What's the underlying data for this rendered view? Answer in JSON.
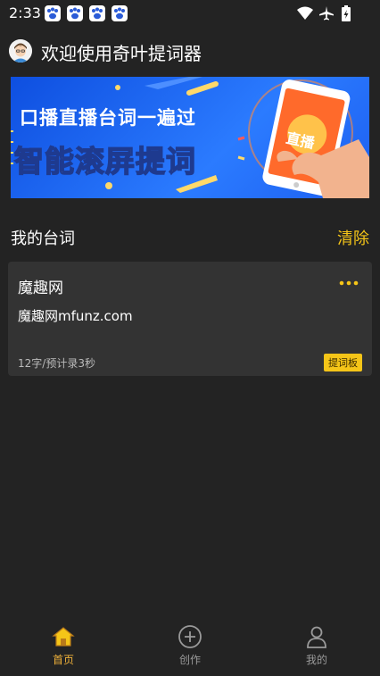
{
  "status_bar": {
    "time": "2:33",
    "notification_icons": [
      "baidu-paw-icon",
      "baidu-paw-icon",
      "baidu-paw-icon",
      "baidu-paw-icon"
    ],
    "system_icons": [
      "wifi-icon",
      "airplane-icon",
      "battery-charging-icon"
    ]
  },
  "header": {
    "title": "欢迎使用奇叶提词器",
    "avatar_icon": "avatar-icon"
  },
  "banner": {
    "line1": "口播直播台词一遍过",
    "line2": "智能滚屏提词",
    "phone_label": "直播"
  },
  "section": {
    "title": "我的台词",
    "clear_label": "清除"
  },
  "scripts": [
    {
      "title": "魔趣网",
      "content": "魔趣网mfunz.com",
      "meta": "12字/预计录3秒",
      "badge": "提词板"
    }
  ],
  "bottom_nav": {
    "items": [
      {
        "label": "首页",
        "icon": "home-icon",
        "active": true
      },
      {
        "label": "创作",
        "icon": "plus-circle-icon",
        "active": false
      },
      {
        "label": "我的",
        "icon": "person-icon",
        "active": false
      }
    ]
  },
  "colors": {
    "background": "#232323",
    "card": "#333333",
    "accent": "#f5c518",
    "nav_active": "#f0b23a",
    "banner_blue": "#1d5ff0"
  }
}
